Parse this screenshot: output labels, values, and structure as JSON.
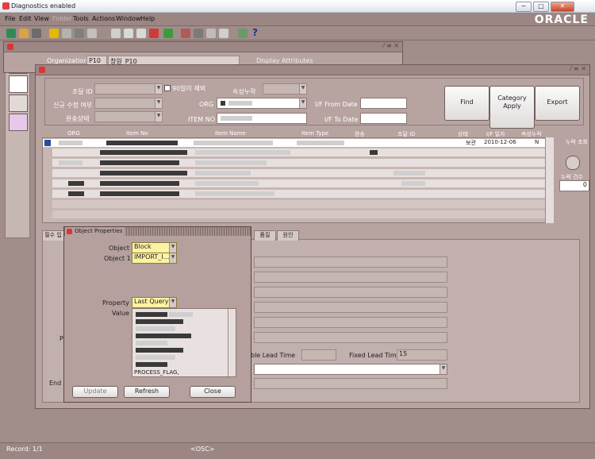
{
  "titlebar": {
    "title": "Diagnostics enabled",
    "buttons": [
      "−",
      "□",
      "✕"
    ]
  },
  "menubar": {
    "items": [
      "File",
      "Edit",
      "View",
      "Folder",
      "Tools",
      "Actions",
      "Window",
      "Help"
    ],
    "brand": "ORACLE"
  },
  "toolbar": {
    "help_glyph": "?"
  },
  "back_window": {
    "win_controls": "⁄ ≡ ✕",
    "organization_label": "Organization",
    "organization_code": "P10",
    "organization_name": "창원_P10",
    "display_attributes": "Display Attributes"
  },
  "front_window": {
    "win_controls": "⁄ ≡ ✕",
    "search": {
      "procure_id_label": "조달 ID",
      "exclude_90_label": "90일이 제외",
      "new_edit_label": "신규 수정 여부",
      "complete_status_label": "완송상태",
      "ledger_label": "속성누락",
      "org_label": "ORG",
      "item_no_label": "ITEM NO",
      "if_from_label": "I/F From Date",
      "if_to_label": "I/F To Date"
    },
    "buttons": {
      "find": "Find",
      "category_apply": "Category Apply",
      "export": "Export"
    },
    "table": {
      "headers": [
        "ORG",
        "Item No",
        "Item Name",
        "Item Type",
        "완송",
        "조달 ID",
        "상태",
        "I/F 일자",
        "속성누락"
      ],
      "first_row": {
        "status": "보관",
        "if_date": "2010-12-06",
        "missing": "N"
      }
    },
    "side": {
      "inquiry_label": "누락 조회",
      "count_label": "누락 건수",
      "count_value": "0"
    },
    "tabs": [
      "필수 입",
      "품질",
      "원인"
    ],
    "fixed_lead_time_label": "Fixed Lead Time",
    "fixed_lead_time_value": "15",
    "variable_lead_time_label": "ble Lead Time",
    "end_label": "End A"
  },
  "object_properties": {
    "title": "Object Properties",
    "object_label": "Object",
    "object_value": "Block",
    "object1_label": "Object 1",
    "object1_value": "IMPORT_I...",
    "property_label": "Property",
    "property_value": "Last Query",
    "value_label": "Value",
    "value_last_line": "PROCESS_FLAG,",
    "buttons": {
      "update": "Update",
      "refresh": "Refresh",
      "close": "Close"
    }
  },
  "statusbar": {
    "record": "Record: 1/1",
    "osc": "<OSC>"
  }
}
